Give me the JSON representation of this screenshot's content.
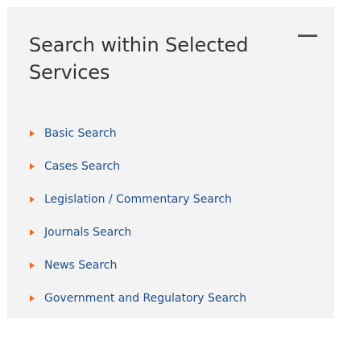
{
  "panel": {
    "title": "Search within Selected Services",
    "collapse_icon": "minus-icon",
    "arrow_icon": "triangle-right-icon",
    "accent_color": "#f06a22",
    "link_color": "#1f4f88",
    "links": [
      {
        "label": "Basic Search"
      },
      {
        "label": "Cases Search"
      },
      {
        "label": "Legislation / Commentary Search"
      },
      {
        "label": "Journals Search"
      },
      {
        "label": "News Search"
      },
      {
        "label": "Government and Regulatory Search"
      }
    ]
  }
}
